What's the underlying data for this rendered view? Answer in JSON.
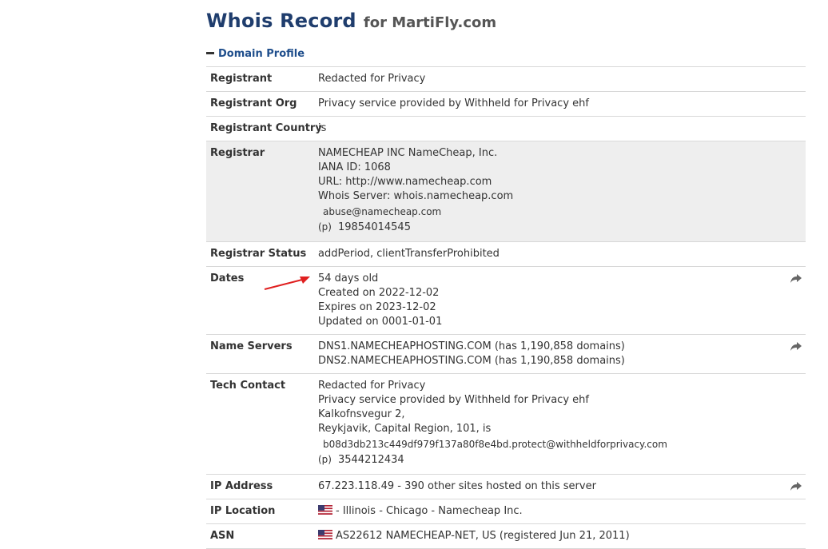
{
  "header": {
    "title_main": "Whois Record",
    "title_for": "for MartiFly.com"
  },
  "section": {
    "label": "Domain Profile",
    "collapse_icon": "minus-icon"
  },
  "rows": [
    {
      "label": "Registrant",
      "lines": [
        "Redacted for Privacy"
      ]
    },
    {
      "label": "Registrant Org",
      "lines": [
        "Privacy service provided by Withheld for Privacy ehf"
      ]
    },
    {
      "label": "Registrant Country",
      "lines": [
        "is"
      ]
    },
    {
      "label": "Registrar",
      "lines": [
        "NAMECHEAP INC NameCheap, Inc.",
        "IANA ID: 1068",
        "URL: http://www.namecheap.com",
        "Whois Server: whois.namecheap.com"
      ],
      "email": "abuse@namecheap.com",
      "phone_tag": "(p)",
      "phone": "19854014545"
    },
    {
      "label": "Registrar Status",
      "lines": [
        "addPeriod, clientTransferProhibited"
      ]
    },
    {
      "label": "Dates",
      "lines": [
        "54 days old",
        "Created on 2022-12-02",
        "Expires on 2023-12-02",
        "Updated on 0001-01-01"
      ]
    },
    {
      "label": "Name Servers",
      "lines": [
        "DNS1.NAMECHEAPHOSTING.COM (has 1,190,858 domains)",
        "DNS2.NAMECHEAPHOSTING.COM (has 1,190,858 domains)"
      ]
    },
    {
      "label": "Tech Contact",
      "lines": [
        "Redacted for Privacy",
        "Privacy service provided by Withheld for Privacy ehf",
        "Kalkofnsvegur 2,",
        "Reykjavik, Capital Region, 101, is"
      ],
      "email": "b08d3db213c449df979f137a80f8e4bd.protect@withheldforprivacy.com",
      "phone_tag": "(p)",
      "phone": "3544212434"
    },
    {
      "label": "IP Address",
      "lines": [
        "67.223.118.49 - 390 other sites hosted on this server"
      ]
    },
    {
      "label": "IP Location",
      "lines": [
        "- Illinois - Chicago - Namecheap Inc."
      ]
    },
    {
      "label": "ASN",
      "lines": [
        "AS22612 NAMECHEAP-NET, US (registered Jun 21, 2011)"
      ]
    }
  ],
  "icons": {
    "share": "share-arrow-icon",
    "flag": "us-flag-icon",
    "annotation": "red-arrow-annotation"
  },
  "colors": {
    "title": "#1f3d6d",
    "section": "#1f4e8c",
    "shaded_row": "#eeeeee",
    "annotation_arrow": "#e02020"
  }
}
